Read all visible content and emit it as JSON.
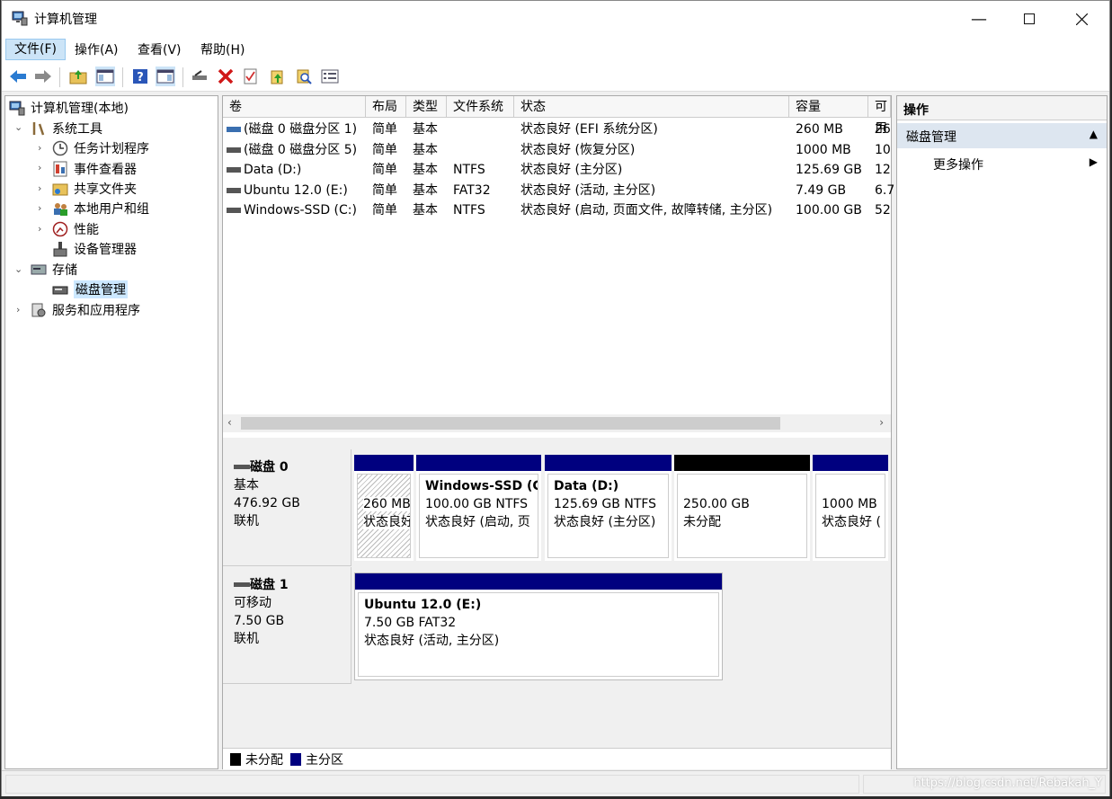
{
  "window": {
    "title": "计算机管理"
  },
  "menu": {
    "items": [
      "文件(F)",
      "操作(A)",
      "查看(V)",
      "帮助(H)"
    ]
  },
  "toolbar": {
    "icons": [
      "back-arrow-icon",
      "forward-arrow-icon",
      "up-folder-icon",
      "show-hide-console-tree-icon",
      "help-icon",
      "show-hide-action-pane-icon",
      "connect-icon",
      "delete-icon",
      "check-properties-icon",
      "up-arrow-folder-icon",
      "find-icon",
      "list-view-icon"
    ]
  },
  "tree": {
    "root": "计算机管理(本地)",
    "system_tools": "系统工具",
    "task_scheduler": "任务计划程序",
    "event_viewer": "事件查看器",
    "shared_folders": "共享文件夹",
    "local_users": "本地用户和组",
    "performance": "性能",
    "device_manager": "设备管理器",
    "storage": "存储",
    "disk_management": "磁盘管理",
    "services_apps": "服务和应用程序"
  },
  "volumes": {
    "headers": [
      "卷",
      "布局",
      "类型",
      "文件系统",
      "状态",
      "容量",
      "可用"
    ],
    "rows": [
      {
        "name": "(磁盘 0 磁盘分区 1)",
        "layout": "简单",
        "type": "基本",
        "fs": "",
        "status": "状态良好 (EFI 系统分区)",
        "capacity": "260 MB",
        "free": "26"
      },
      {
        "name": "(磁盘 0 磁盘分区 5)",
        "layout": "简单",
        "type": "基本",
        "fs": "",
        "status": "状态良好 (恢复分区)",
        "capacity": "1000 MB",
        "free": "10"
      },
      {
        "name": "Data (D:)",
        "layout": "简单",
        "type": "基本",
        "fs": "NTFS",
        "status": "状态良好 (主分区)",
        "capacity": "125.69 GB",
        "free": "12"
      },
      {
        "name": "Ubuntu 12.0 (E:)",
        "layout": "简单",
        "type": "基本",
        "fs": "FAT32",
        "status": "状态良好 (活动, 主分区)",
        "capacity": "7.49 GB",
        "free": "6.7"
      },
      {
        "name": "Windows-SSD (C:)",
        "layout": "简单",
        "type": "基本",
        "fs": "NTFS",
        "status": "状态良好 (启动, 页面文件, 故障转储, 主分区)",
        "capacity": "100.00 GB",
        "free": "52"
      }
    ]
  },
  "disks": [
    {
      "name": "磁盘 0",
      "kind": "基本",
      "size": "476.92 GB",
      "state": "联机",
      "parts": [
        {
          "title": "",
          "line1": "260 MB",
          "line2": "状态良好",
          "color": "#00007f",
          "hatch": true
        },
        {
          "title": "Windows-SSD (C:)",
          "line1": "100.00 GB NTFS",
          "line2": "状态良好 (启动, 页",
          "color": "#00007f"
        },
        {
          "title": "Data  (D:)",
          "line1": "125.69 GB NTFS",
          "line2": "状态良好 (主分区)",
          "color": "#00007f"
        },
        {
          "title": "",
          "line1": "250.00 GB",
          "line2": "未分配",
          "color": "#000000"
        },
        {
          "title": "",
          "line1": "1000 MB",
          "line2": "状态良好 (",
          "color": "#00007f"
        }
      ]
    },
    {
      "name": "磁盘 1",
      "kind": "可移动",
      "size": "7.50 GB",
      "state": "联机",
      "parts": [
        {
          "title": "Ubuntu 12.0  (E:)",
          "line1": "7.50 GB FAT32",
          "line2": "状态良好 (活动, 主分区)",
          "color": "#00007f"
        }
      ]
    }
  ],
  "legend": {
    "unallocated": "未分配",
    "primary": "主分区",
    "unallocated_color": "#000000",
    "primary_color": "#00007f"
  },
  "actions": {
    "header": "操作",
    "selected": "磁盘管理",
    "more": "更多操作"
  },
  "watermark": "https://blog.csdn.net/Rebakah_Y"
}
